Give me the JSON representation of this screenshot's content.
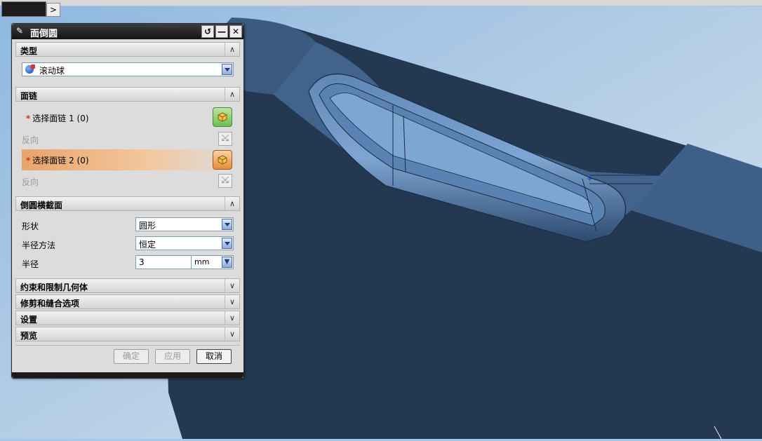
{
  "dialog": {
    "title": "面倒圆",
    "title_icons": {
      "reset": "reset-icon",
      "minimize": "minimize-icon",
      "close": "close-icon"
    }
  },
  "sections": {
    "type": {
      "header": "类型",
      "combo_value": "滚动球"
    },
    "face_chain": {
      "header": "面链",
      "select1_label": "选择面链 1 (0)",
      "reverse1_label": "反向",
      "select2_label": "选择面链 2 (0)",
      "reverse2_label": "反向"
    },
    "cross_section": {
      "header": "倒圆横截面",
      "shape_label": "形状",
      "shape_value": "圆形",
      "radius_method_label": "半径方法",
      "radius_method_value": "恒定",
      "radius_label": "半径",
      "radius_value": "3",
      "radius_unit": "mm"
    },
    "collapsed": [
      {
        "header": "约束和限制几何体"
      },
      {
        "header": "修剪和缝合选项"
      },
      {
        "header": "设置"
      },
      {
        "header": "预览"
      }
    ]
  },
  "buttons": {
    "ok": "确定",
    "apply": "应用",
    "cancel": "取消"
  },
  "colors": {
    "active_row": "#e9a46b",
    "viewport_bg": "#a6c7e6",
    "model_face": "#2c3f58"
  }
}
